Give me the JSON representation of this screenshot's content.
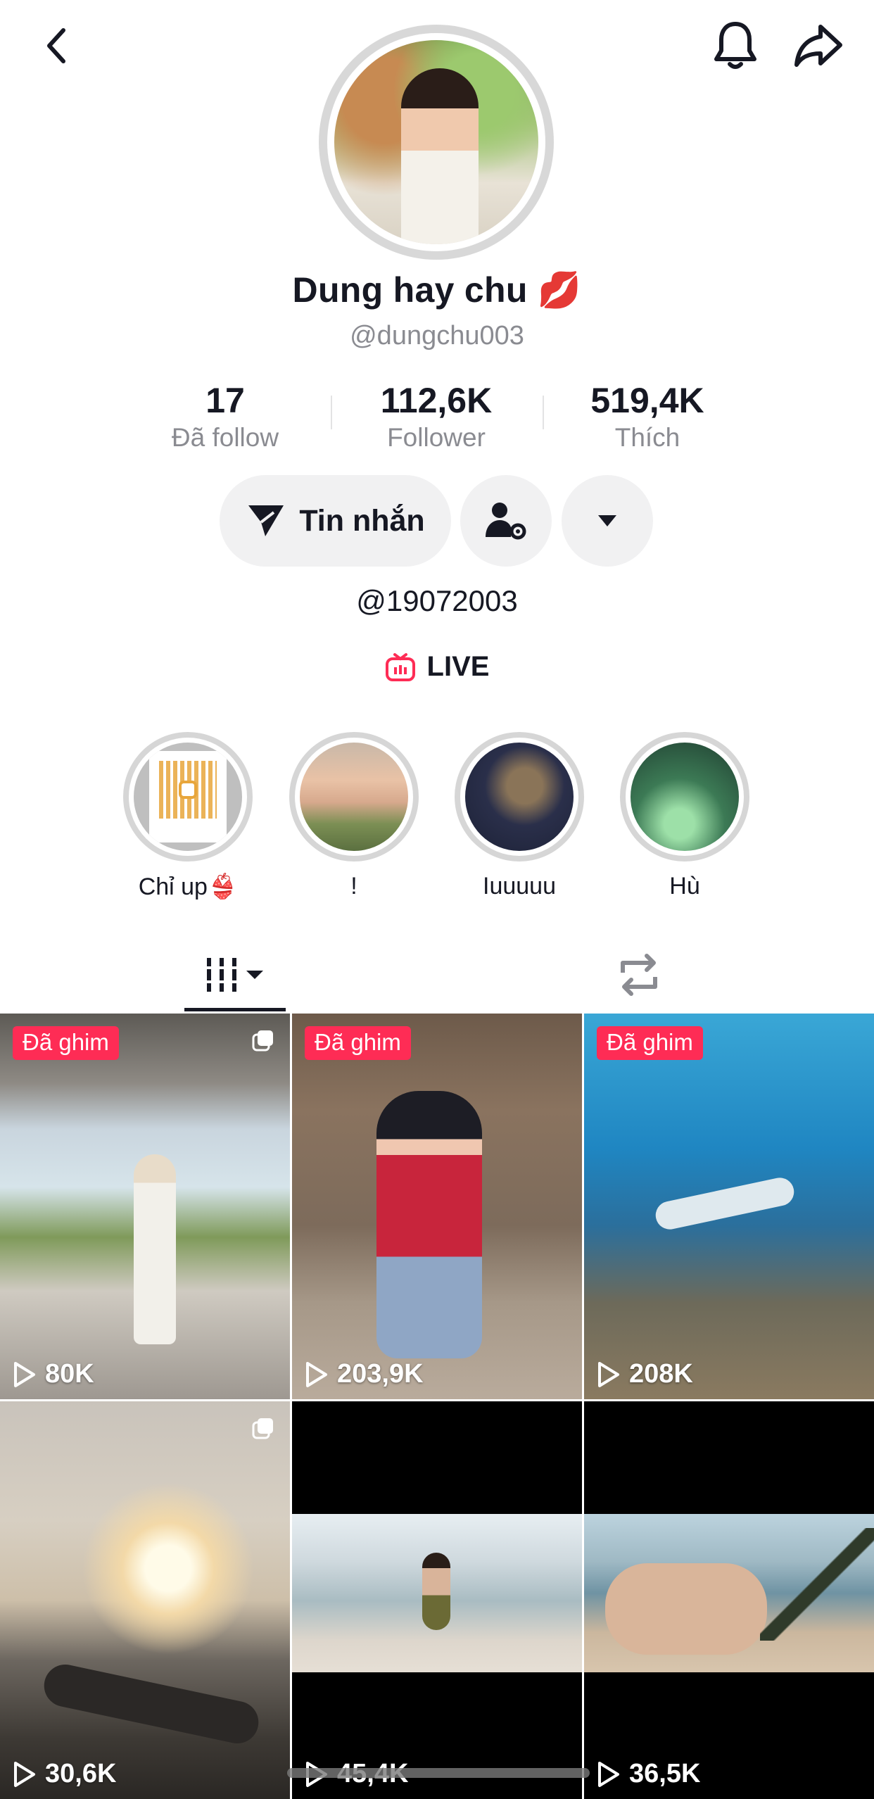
{
  "header": {
    "back_icon": "chevron-left-icon",
    "bell_icon": "bell-icon",
    "share_icon": "share-arrow-icon"
  },
  "profile": {
    "display_name": "Dung hay chu",
    "name_emoji": "💋",
    "username": "@dungchu003",
    "bio": "@19072003"
  },
  "stats": [
    {
      "value": "17",
      "label": "Đã follow"
    },
    {
      "value": "112,6K",
      "label": "Follower"
    },
    {
      "value": "519,4K",
      "label": "Thích"
    }
  ],
  "actions": {
    "message_label": "Tin nhắn",
    "add_friend_icon": "user-settings-icon",
    "more_icon": "caret-down-icon"
  },
  "live": {
    "label": "LIVE",
    "icon": "live-tv-icon",
    "color": "#fe2c55"
  },
  "highlights": [
    {
      "label": "Chỉ up👙"
    },
    {
      "label": "!"
    },
    {
      "label": "Iuuuuu"
    },
    {
      "label": "Hù"
    }
  ],
  "tabs": {
    "videos_icon": "grid-icon",
    "reposts_icon": "repost-icon"
  },
  "videos": [
    {
      "pinned": "Đã ghim",
      "views": "80K"
    },
    {
      "pinned": "Đã ghim",
      "views": "203,9K"
    },
    {
      "pinned": "Đã ghim",
      "views": "208K"
    },
    {
      "pinned": "",
      "views": "30,6K"
    },
    {
      "pinned": "",
      "views": "45,4K"
    },
    {
      "pinned": "",
      "views": "36,5K"
    }
  ],
  "colors": {
    "accent": "#fe2c55",
    "text": "#161823",
    "secondary": "#8a8b91",
    "button_bg": "#f1f1f2"
  }
}
